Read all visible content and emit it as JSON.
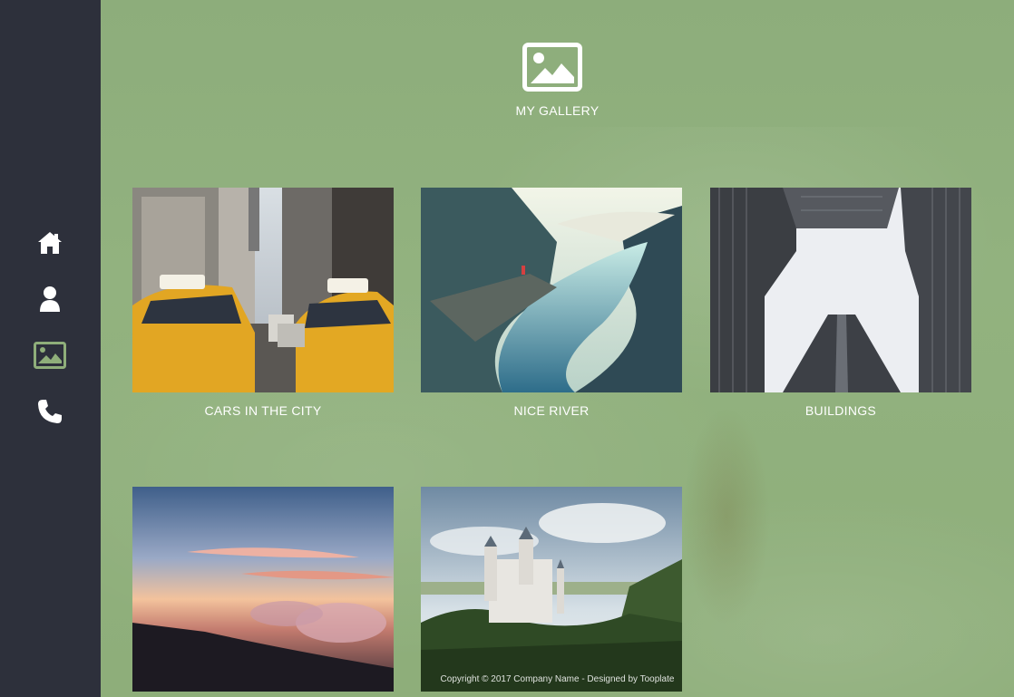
{
  "sidebar": {
    "items": [
      {
        "name": "home",
        "icon": "home-icon"
      },
      {
        "name": "about",
        "icon": "user-icon"
      },
      {
        "name": "gallery",
        "icon": "image-icon",
        "active": true
      },
      {
        "name": "contact",
        "icon": "phone-icon"
      }
    ],
    "active_color": "#8fae7a",
    "icon_color": "#ffffff"
  },
  "header": {
    "icon": "image-icon",
    "title": "MY GALLERY"
  },
  "gallery": {
    "items": [
      {
        "caption": "CARS IN THE CITY",
        "image": "taxi-street-photo"
      },
      {
        "caption": "NICE RIVER",
        "image": "fjord-river-photo"
      },
      {
        "caption": "BUILDINGS",
        "image": "skyscrapers-photo"
      },
      {
        "caption": "",
        "image": "sunset-clouds-photo"
      },
      {
        "caption": "",
        "image": "castle-forest-photo"
      }
    ]
  },
  "footer": {
    "text": "Copyright © 2017 Company Name - Designed by Tooplate"
  },
  "colors": {
    "sidebar_bg": "#2d303b",
    "main_bg": "#8fae7a",
    "text": "#ffffff"
  }
}
